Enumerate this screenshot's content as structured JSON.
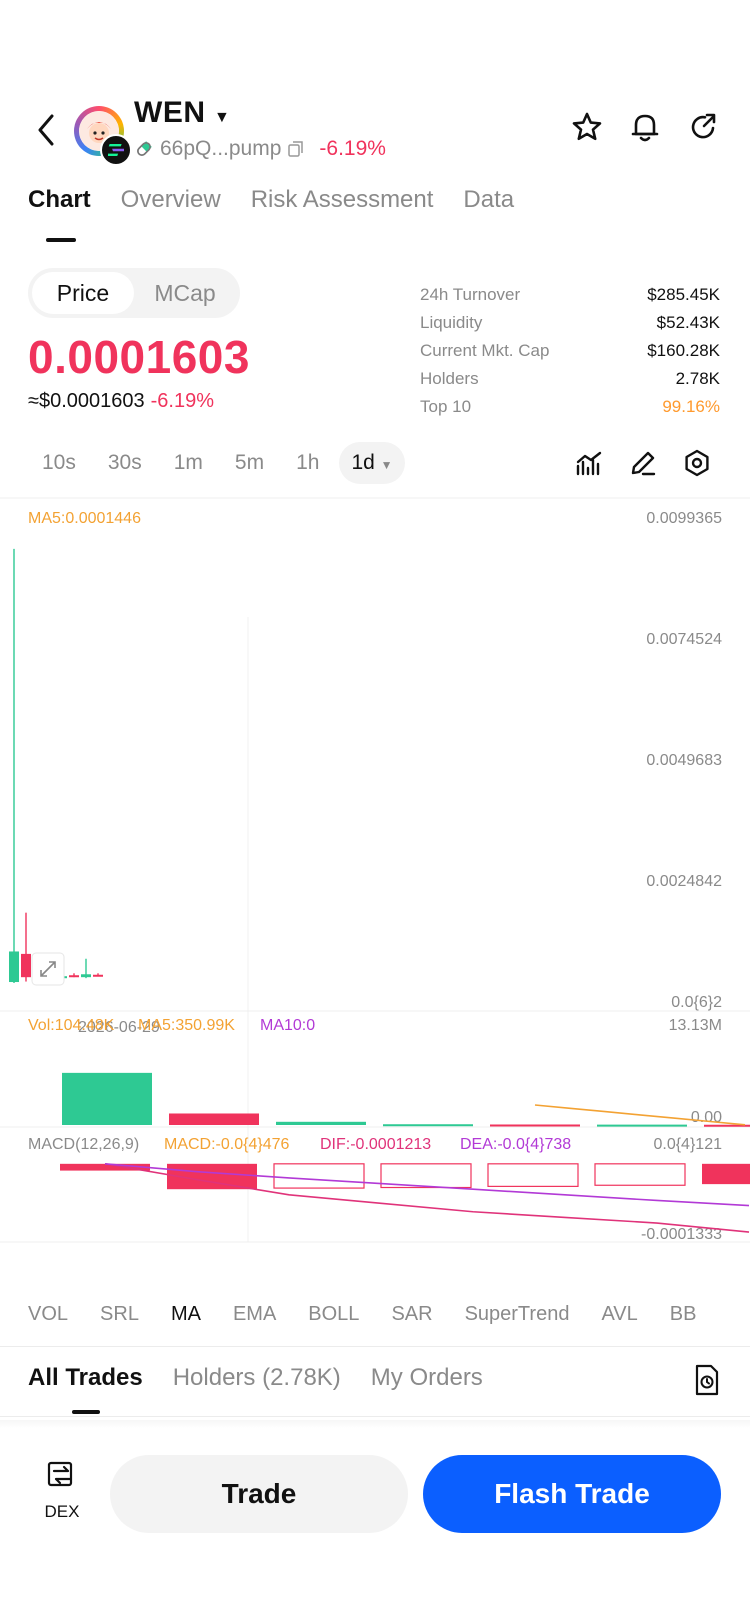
{
  "header": {
    "token_name": "WEN",
    "address": "66pQ...pump",
    "change": "-6.19%"
  },
  "tabs": [
    "Chart",
    "Overview",
    "Risk Assessment",
    "Data"
  ],
  "toggle": {
    "price": "Price",
    "mcap": "MCap"
  },
  "price": {
    "value": "0.0001603",
    "usd": "≈$0.0001603",
    "change": "-6.19%"
  },
  "stats": [
    {
      "label": "24h  Turnover",
      "value": "$285.45K"
    },
    {
      "label": "Liquidity",
      "value": "$52.43K"
    },
    {
      "label": "Current Mkt. Cap",
      "value": "$160.28K"
    },
    {
      "label": "Holders",
      "value": "2.78K"
    },
    {
      "label": "Top 10",
      "value": "99.16%"
    }
  ],
  "timeframes": [
    "10s",
    "30s",
    "1m",
    "5m",
    "1h",
    "1d"
  ],
  "chart_data": [
    {
      "type": "candlestick",
      "legend": "MA5:0.0001446",
      "y_ticks": [
        "0.0099365",
        "0.0074524",
        "0.0049683",
        "0.0024842",
        "0.0{6}2"
      ],
      "ylim": [
        0,
        0.0099365
      ],
      "x_tick": "2026-06-29",
      "candles": [
        {
          "open": 0.00065,
          "high": 0.00895,
          "low": 0.0,
          "close": 2e-05,
          "direction": "up"
        },
        {
          "open": 0.0006,
          "high": 0.00145,
          "low": 3e-05,
          "close": 0.00012,
          "direction": "down"
        },
        {
          "open": 0.0002,
          "high": 0.00035,
          "low": 8e-05,
          "close": 0.00012,
          "direction": "up"
        },
        {
          "open": 0.00012,
          "high": 0.00018,
          "low": 6e-05,
          "close": 0.0001,
          "direction": "down"
        },
        {
          "open": 0.00014,
          "high": 0.0002,
          "low": 0.0001,
          "close": 0.00012,
          "direction": "up"
        },
        {
          "open": 0.00016,
          "high": 0.0002,
          "low": 0.00012,
          "close": 0.00014,
          "direction": "down"
        },
        {
          "open": 0.00018,
          "high": 0.0005,
          "low": 0.0001,
          "close": 0.00012,
          "direction": "up"
        },
        {
          "open": 0.00017,
          "high": 0.0002,
          "low": 0.00014,
          "close": 0.00016,
          "direction": "down"
        }
      ]
    },
    {
      "type": "bar",
      "title_vol": "Vol:104.48K",
      "title_ma5": "MA5:350.99K",
      "title_ma10": "MA10:0",
      "y_ticks": [
        "13.13M",
        "0.00"
      ],
      "ylim": [
        0,
        13130000
      ],
      "values": [
        8150000,
        1800000,
        500000,
        120000,
        80000,
        60000,
        40000
      ],
      "directions": [
        "up",
        "down",
        "up",
        "up",
        "down",
        "up",
        "down"
      ],
      "ma_line": [
        4200000,
        3500000,
        2800000,
        2100000,
        1400000,
        700000,
        200000
      ]
    },
    {
      "type": "macd",
      "title": "MACD(12,26,9)",
      "macd_label": "MACD:-0.0{4}476",
      "dif_label": "DIF:-0.0001213",
      "dea_label": "DEA:-0.0{4}738",
      "y_ticks": [
        "0.0{4}121",
        "-0.0001333"
      ],
      "ylim": [
        -0.0001333,
        1.21e-05
      ],
      "hist": [
        -1.2e-05,
        -4.5e-05,
        -4.3e-05,
        -4.2e-05,
        -4e-05,
        -3.8e-05,
        -3.6e-05,
        -3.4e-05
      ],
      "hist_filled": [
        true,
        true,
        false,
        false,
        false,
        false,
        true,
        true
      ],
      "dif": [
        0.0,
        -2.8e-05,
        -5.5e-05,
        -7e-05,
        -8.5e-05,
        -9.5e-05,
        -0.000105,
        -0.000121
      ],
      "dea": [
        0.0,
        -1.4e-05,
        -2.5e-05,
        -3.5e-05,
        -4.5e-05,
        -5.5e-05,
        -6.5e-05,
        -7.4e-05
      ]
    }
  ],
  "indicators": [
    "VOL",
    "SRL",
    "MA",
    "EMA",
    "BOLL",
    "SAR",
    "SuperTrend",
    "AVL",
    "BB"
  ],
  "bottom_tabs": [
    "All Trades",
    "Holders (2.78K)",
    "My Orders"
  ],
  "actions": {
    "dex": "DEX",
    "trade": "Trade",
    "flash": "Flash Trade"
  },
  "colors": {
    "up": "#2ec993",
    "down": "#f0335c",
    "accent": "#0b5fff",
    "ma5": "#f3a233",
    "ma10": "#b23ad6"
  }
}
